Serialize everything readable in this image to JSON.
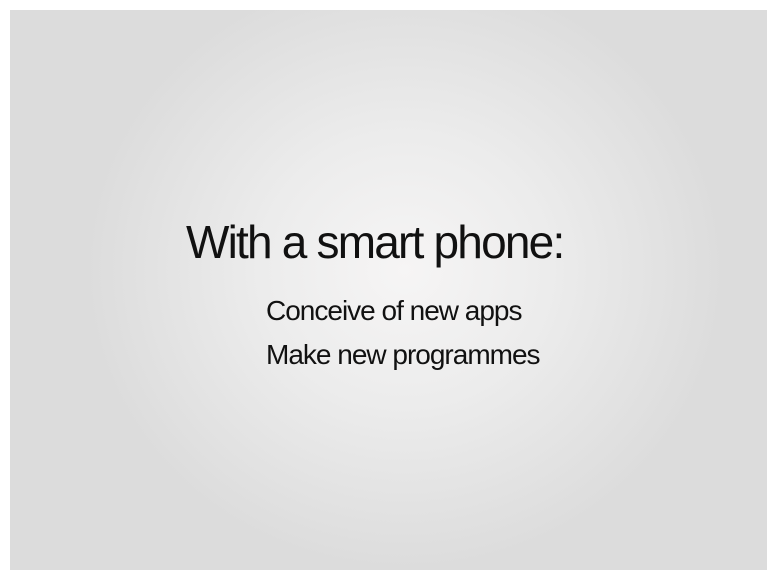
{
  "slide": {
    "title": "With a smart phone:",
    "bullets": [
      "Conceive of new apps",
      "Make new programmes"
    ]
  }
}
